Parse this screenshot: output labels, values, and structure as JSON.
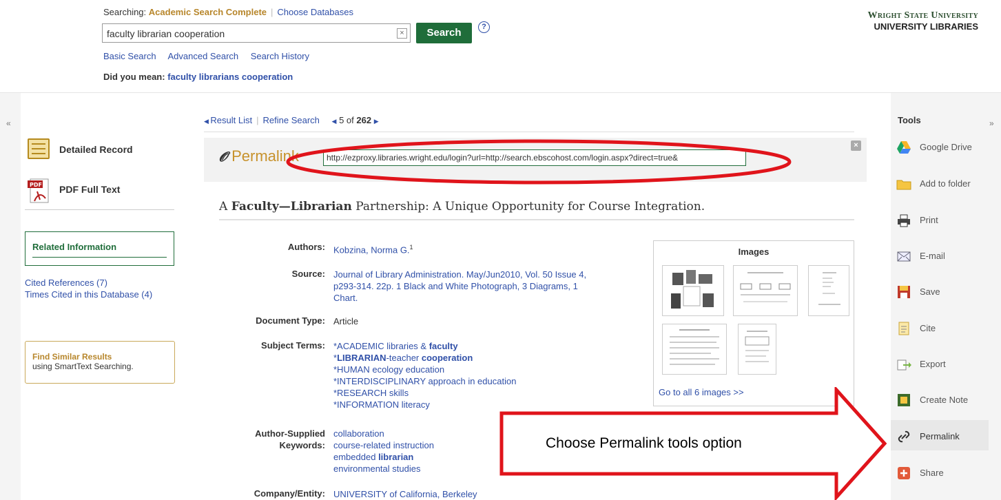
{
  "header": {
    "searching_label": "Searching:",
    "database": "Academic Search Complete",
    "choose_databases": "Choose Databases",
    "search_value": "faculty librarian cooperation",
    "search_button": "Search",
    "help_icon": "?",
    "links": [
      "Basic Search",
      "Advanced Search",
      "Search History"
    ],
    "did_you_mean_label": "Did you mean:",
    "did_you_mean_value": "faculty librarians cooperation",
    "brand_line1": "Wright State University",
    "brand_line2": "UNIVERSITY LIBRARIES"
  },
  "left": {
    "collapse": "«",
    "detailed_record": "Detailed Record",
    "pdf_full_text": "PDF Full Text",
    "pdf_icon_text": "PDF",
    "related_title": "Related Information",
    "related_links": [
      "Cited References (7)",
      "Times Cited in this Database (4)"
    ],
    "similar_title": "Find Similar Results",
    "similar_sub": "using SmartText Searching."
  },
  "nav": {
    "result_list": "Result List",
    "refine_search": "Refine Search",
    "position_prefix": "5 of",
    "position_total": "262"
  },
  "permalink": {
    "title": "Permalink",
    "url": "http://ezproxy.libraries.wright.edu/login?url=http://search.ebscohost.com/login.aspx?direct=true&",
    "close": "×"
  },
  "article": {
    "title_a": "A ",
    "title_b1": "Faculty",
    "title_dash": "—",
    "title_b2": "Librarian",
    "title_rest": " Partnership: A Unique Opportunity for Course Integration.",
    "fields": {
      "authors_label": "Authors:",
      "authors_value": "Kobzina, Norma G.",
      "authors_sup": "1",
      "source_label": "Source:",
      "source_link": "Journal of Library Administration",
      "source_line1_rest": ". May/Jun2010, Vol. 50 Issue 4,",
      "source_line2": "p293-314. 22p. 1 Black and White Photograph, 3 Diagrams, 1",
      "source_line3": "Chart.",
      "doctype_label": "Document Type:",
      "doctype_value": "Article",
      "subject_label": "Subject Terms:",
      "subjects": [
        {
          "pre": "*ACADEMIC libraries & ",
          "bold": "faculty",
          "post": ""
        },
        {
          "pre": "*",
          "bold": "LIBRARIAN",
          "post": "-teacher ",
          "bold2": "cooperation"
        },
        {
          "pre": "*HUMAN ecology education",
          "bold": "",
          "post": ""
        },
        {
          "pre": "*INTERDISCIPLINARY approach in education",
          "bold": "",
          "post": ""
        },
        {
          "pre": "*RESEARCH skills",
          "bold": "",
          "post": ""
        },
        {
          "pre": "*INFORMATION literacy",
          "bold": "",
          "post": ""
        }
      ],
      "author_kw_label1": "Author-Supplied",
      "author_kw_label2": "Keywords:",
      "keywords": [
        "collaboration",
        "course-related instruction",
        "embedded ",
        "environmental studies"
      ],
      "keyword_bold": "librarian",
      "company_label": "Company/Entity:",
      "company_value": "UNIVERSITY of California, Berkeley"
    }
  },
  "images": {
    "title": "Images",
    "go_all": "Go to all 6 images >>"
  },
  "tools": {
    "title": "Tools",
    "collapse": "»",
    "items": [
      "Google Drive",
      "Add to folder",
      "Print",
      "E-mail",
      "Save",
      "Cite",
      "Export",
      "Create Note",
      "Permalink",
      "Share"
    ]
  },
  "annotation": {
    "callout": "Choose Permalink tools option"
  }
}
